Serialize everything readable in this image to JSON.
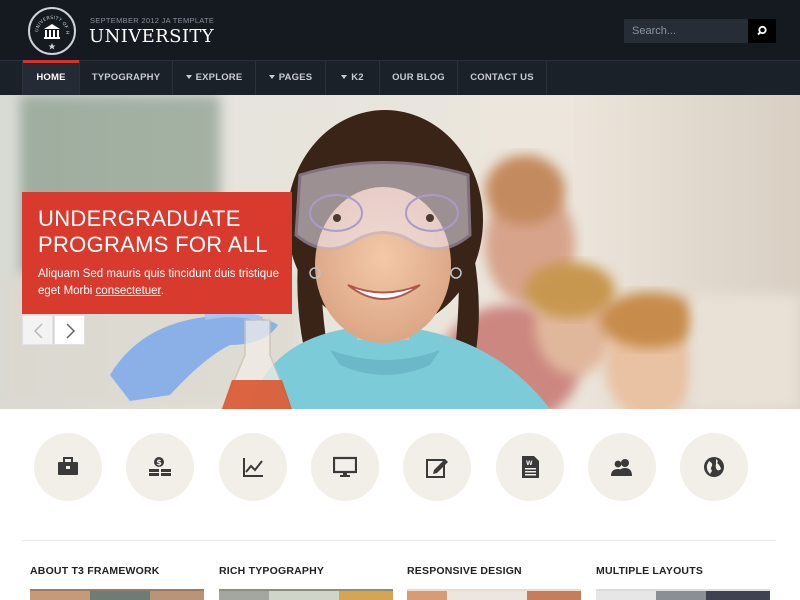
{
  "header": {
    "tagline": "SEPTEMBER 2012 JA TEMPLATE",
    "title": "UNIVERSITY",
    "seal_text": "UNIVERSITY OF HARVERSE",
    "search_placeholder": "Search..."
  },
  "nav": {
    "items": [
      {
        "label": "HOME",
        "active": true
      },
      {
        "label": "TYPOGRAPHY"
      },
      {
        "label": "EXPLORE",
        "dropdown": true
      },
      {
        "label": "PAGES",
        "dropdown": true
      },
      {
        "label": "K2",
        "dropdown": true
      },
      {
        "label": "OUR BLOG"
      },
      {
        "label": "CONTACT US"
      }
    ]
  },
  "hero": {
    "title_line1": "UNDERGRADUATE",
    "title_line2": "PROGRAMS FOR ALL",
    "text": "Aliquam Sed mauris quis tincidunt duis tristique eget Morbi",
    "link": "consectetuer",
    "text_end": "."
  },
  "features": {
    "icons": [
      "briefcase-icon",
      "money-icon",
      "chart-icon",
      "monitor-icon",
      "edit-icon",
      "document-icon",
      "users-icon",
      "globe-icon"
    ]
  },
  "columns": [
    {
      "title": "ABOUT T3 FRAMEWORK"
    },
    {
      "title": "RICH TYPOGRAPHY"
    },
    {
      "title": "RESPONSIVE DESIGN"
    },
    {
      "title": "MULTIPLE LAYOUTS"
    }
  ],
  "colors": {
    "accent": "#d83a2d",
    "header_bg": "#151a21",
    "nav_bg": "#1b2129",
    "icon_circle": "#f1efe8"
  }
}
